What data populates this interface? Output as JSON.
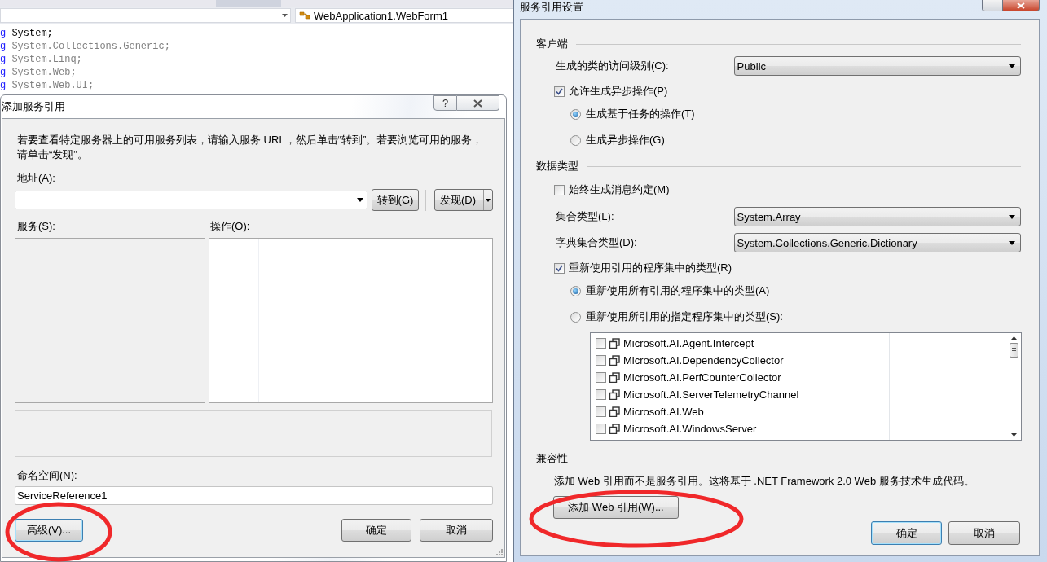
{
  "editor": {
    "member_dropdown": "WebApplication1.WebForm1",
    "code_lines": [
      {
        "keyword": "g",
        "text": "System;",
        "unused": false
      },
      {
        "keyword": "g",
        "text": "System.Collections.Generic;",
        "unused": true
      },
      {
        "keyword": "g",
        "text": "System.Linq;",
        "unused": true
      },
      {
        "keyword": "g",
        "text": "System.Web;",
        "unused": true
      },
      {
        "keyword": "g",
        "text": "System.Web.UI;",
        "unused": true
      }
    ]
  },
  "add_service_reference": {
    "title": "添加服务引用",
    "help_button": "?",
    "instructions": "若要查看特定服务器上的可用服务列表，请输入服务 URL，然后单击“转到”。若要浏览可用的服务，请单击“发现”。",
    "address_label": "地址(A):",
    "go_button": "转到(G)",
    "discover_button": "发现(D)",
    "services_label": "服务(S):",
    "operations_label": "操作(O):",
    "namespace_label": "命名空间(N):",
    "namespace_value": "ServiceReference1",
    "advanced_button": {
      "label": "高级(V)...",
      "highlighted": true
    },
    "ok_button": "确定",
    "cancel_button": "取消"
  },
  "service_reference_settings": {
    "title": "服务引用设置",
    "sections": [
      {
        "title": "客户端",
        "rows": [
          {
            "kind": "dropdown",
            "label": "生成的类的访问级别(C):",
            "value": "Public"
          },
          {
            "kind": "checkbox",
            "label": "允许生成异步操作(P)",
            "checked": true
          },
          {
            "kind": "radio",
            "label": "生成基于任务的操作(T)",
            "selected": true
          },
          {
            "kind": "radio",
            "label": "生成异步操作(G)",
            "selected": false
          }
        ]
      },
      {
        "title": "数据类型",
        "rows": [
          {
            "kind": "checkbox",
            "label": "始终生成消息约定(M)",
            "checked": false
          },
          {
            "kind": "dropdown",
            "label": "集合类型(L):",
            "value": "System.Array"
          },
          {
            "kind": "dropdown",
            "label": "字典集合类型(D):",
            "value": "System.Collections.Generic.Dictionary"
          },
          {
            "kind": "checkbox",
            "label": "重新使用引用的程序集中的类型(R)",
            "checked": true
          },
          {
            "kind": "radio",
            "label": "重新使用所有引用的程序集中的类型(A)",
            "selected": true
          },
          {
            "kind": "radio",
            "label": "重新使用所引用的指定程序集中的类型(S):",
            "selected": false
          },
          {
            "kind": "assembly_list",
            "items": [
              {
                "name": "Microsoft.AI.Agent.Intercept",
                "checked": false
              },
              {
                "name": "Microsoft.AI.DependencyCollector",
                "checked": false
              },
              {
                "name": "Microsoft.AI.PerfCounterCollector",
                "checked": false
              },
              {
                "name": "Microsoft.AI.ServerTelemetryChannel",
                "checked": false
              },
              {
                "name": "Microsoft.AI.Web",
                "checked": false
              },
              {
                "name": "Microsoft.AI.WindowsServer",
                "checked": false
              }
            ]
          }
        ]
      },
      {
        "title": "兼容性",
        "rows": [
          {
            "kind": "text",
            "text": "添加 Web 引用而不是服务引用。这将基于 .NET Framework 2.0 Web 服务技术生成代码。"
          },
          {
            "kind": "button",
            "label": "添加 Web 引用(W)...",
            "highlighted": true
          }
        ]
      }
    ],
    "ok_button": "确定",
    "cancel_button": "取消"
  }
}
